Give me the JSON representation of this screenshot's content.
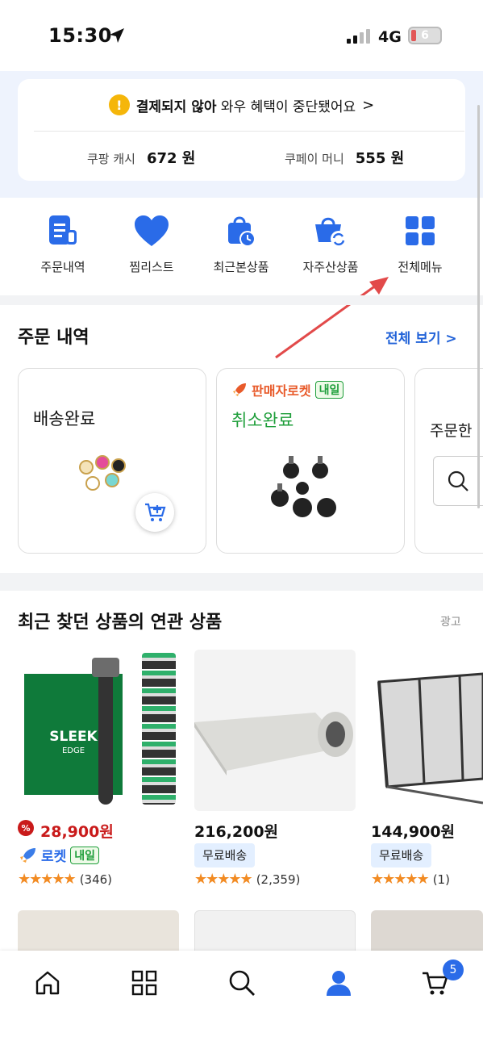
{
  "status_bar": {
    "time": "15:30",
    "network": "4G",
    "battery": "6"
  },
  "payment_alert": {
    "bold": "결제되지 않아",
    "rest": " 와우 혜택이 중단됐어요",
    "chevron": ">"
  },
  "balances": [
    {
      "label": "쿠팡 캐시",
      "value": "672 원"
    },
    {
      "label": "쿠페이 머니",
      "value": "555 원"
    }
  ],
  "quick_menu": [
    {
      "label": "주문내역",
      "icon": "receipt-icon"
    },
    {
      "label": "찜리스트",
      "icon": "heart-icon"
    },
    {
      "label": "최근본상품",
      "icon": "recent-bag-icon"
    },
    {
      "label": "자주산상품",
      "icon": "basket-refresh-icon"
    },
    {
      "label": "전체메뉴",
      "icon": "grid-icon"
    }
  ],
  "orders": {
    "title": "주문 내역",
    "view_all": "전체 보기 >",
    "cards": [
      {
        "status": "배송완료"
      },
      {
        "badge": "판매자로켓",
        "badge_sub": "내일",
        "status": "취소완료"
      },
      {
        "status": "주문한"
      }
    ]
  },
  "recommend": {
    "title": "최근 찾던 상품의 연관 상품",
    "ad": "광고",
    "products": [
      {
        "price": "28,900원",
        "badge": "로켓",
        "badge_sub": "내일",
        "rating": "★★★★★",
        "reviews": "(346)",
        "sale_icon": "%",
        "art": [
          "SLEEK",
          "EDGE"
        ]
      },
      {
        "price": "216,200원",
        "tag": "무료배송",
        "rating": "★★★★★",
        "reviews": "(2,359)"
      },
      {
        "price": "144,900원",
        "tag": "무료배송",
        "rating": "★★★★★",
        "reviews": "(1)"
      }
    ]
  },
  "bottom_nav": [
    "home-icon",
    "category-grid-icon",
    "search-icon",
    "my-coupang-icon",
    "cart-icon"
  ],
  "cart_count": "5",
  "colors": {
    "accent": "#2a6be8",
    "price_red": "#c91a1a",
    "rocket_green": "#1e9e3a",
    "header_bg": "#eef3fd"
  }
}
